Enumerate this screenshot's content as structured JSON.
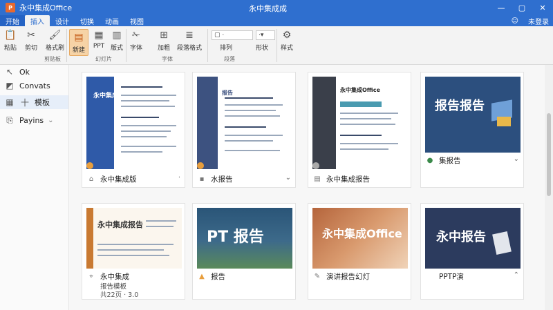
{
  "app": {
    "logo": "P",
    "name": "永中集成Office",
    "window_title": "永中集成成"
  },
  "window_controls": {
    "minimize": "—",
    "restore": "▢",
    "close": "✕"
  },
  "tabs": [
    {
      "label": "开始"
    },
    {
      "label": "插入"
    },
    {
      "label": "设计"
    },
    {
      "label": "切换"
    },
    {
      "label": "动画"
    },
    {
      "label": "视图"
    }
  ],
  "tab_right": {
    "user": "未登录"
  },
  "ribbon": {
    "buttons": [
      {
        "label": "粘贴",
        "icon": "paste-icon"
      },
      {
        "label": "剪切",
        "icon": "cut-icon"
      },
      {
        "label": "格式刷",
        "icon": "format-painter-icon"
      },
      {
        "label": "新建",
        "icon": "new-slide-icon"
      },
      {
        "label": "PPT",
        "icon": "ppt-icon"
      },
      {
        "label": "版式",
        "icon": "layout-icon"
      },
      {
        "label": "字体",
        "icon": "font-icon"
      },
      {
        "label": "加粗",
        "icon": "bold-icon"
      },
      {
        "label": "段落格式",
        "icon": "paragraph-icon"
      },
      {
        "label": "排列",
        "icon": "arrange-icon"
      },
      {
        "label": "形状",
        "icon": "shape-icon"
      },
      {
        "label": "样式",
        "icon": "style-icon"
      }
    ],
    "groups": [
      "剪贴板",
      "幻灯片",
      "字体",
      "段落"
    ]
  },
  "leftnav": [
    {
      "label": "Ok",
      "icon": "back-icon"
    },
    {
      "label": "Convats",
      "icon": "template-icon"
    },
    {
      "label": "模板",
      "icon": "layout-grid-icon"
    },
    {
      "label": "Payins",
      "icon": "plugin-icon"
    }
  ],
  "cards": [
    {
      "caption": "永中集成版",
      "icon": "home-icon",
      "thumb_title": "永中集成",
      "accent": "#2f5aa8"
    },
    {
      "caption": "水报告",
      "icon": "folder-icon",
      "thumb_title": "报告",
      "accent": "#3d5280"
    },
    {
      "caption": "永中集成报告",
      "icon": "pdf-icon",
      "thumb_title": "永中集成Office",
      "accent": "#3a3f4a"
    },
    {
      "caption": "集报告",
      "icon": "dot-icon",
      "thumb_title": "报告报告",
      "accent": "#2c4f7e"
    },
    {
      "caption": "永中集成",
      "sub": "报告模板",
      "meta": "共22页 · 3.0",
      "icon": "pin-icon",
      "thumb_title": "永中集成报告",
      "accent": "#c97a32"
    },
    {
      "caption": "报告",
      "icon": "lock-icon",
      "thumb_title": "PT 报告",
      "accent": "#2a5578"
    },
    {
      "caption": "演讲报告幻灯",
      "icon": "tool-icon",
      "thumb_title": "永中集成Office",
      "accent": "#d08a5a"
    },
    {
      "caption": "PPTP演",
      "icon": "none",
      "thumb_title": "永中报告",
      "accent": "#2c3b5e"
    }
  ],
  "colors": {
    "brand": "#2f6fcf",
    "orange": "#e8692f"
  }
}
